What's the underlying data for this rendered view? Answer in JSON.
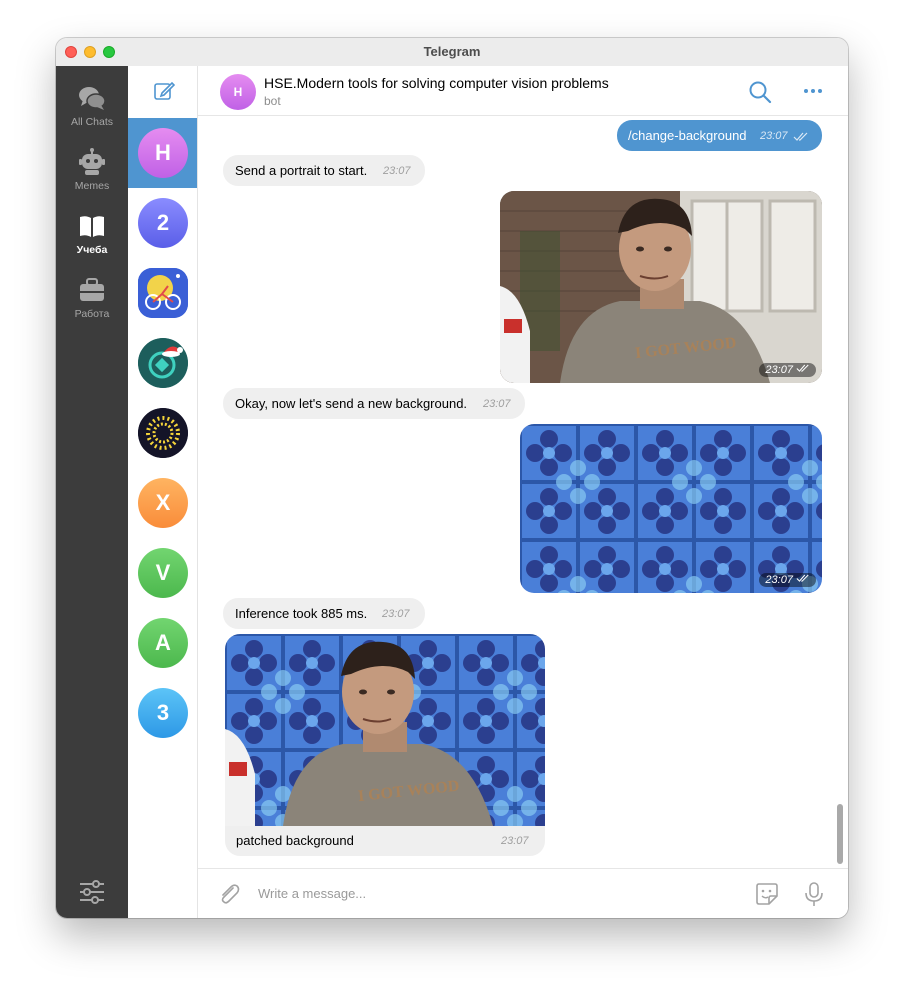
{
  "window": {
    "title": "Telegram"
  },
  "folders": [
    {
      "label": "All Chats",
      "icon": "chat-bubbles-icon"
    },
    {
      "label": "Memes",
      "icon": "robot-icon"
    },
    {
      "label": "Учеба",
      "icon": "book-icon",
      "active": true
    },
    {
      "label": "Работа",
      "icon": "briefcase-icon"
    }
  ],
  "chat_list": {
    "compose_icon": "compose-icon",
    "avatars": [
      {
        "letter": "H",
        "color": "#c866e8",
        "active": true
      },
      {
        "letter": "2",
        "color": "#6c6df2"
      },
      {
        "letter": "",
        "color": "#3f6fe0"
      },
      {
        "letter": "",
        "color": "#1f6e6b"
      },
      {
        "letter": "",
        "color": "#151530"
      },
      {
        "letter": "X",
        "color": "#fb9a45"
      },
      {
        "letter": "V",
        "color": "#58c55b"
      },
      {
        "letter": "A",
        "color": "#58c55b"
      },
      {
        "letter": "3",
        "color": "#3aa6ee"
      }
    ]
  },
  "chat": {
    "avatar_letter": "H",
    "name": "HSE.Modern tools for solving computer vision problems",
    "status": "bot"
  },
  "messages": {
    "m1": {
      "text": "/change-background",
      "time": "23:07"
    },
    "m2": {
      "text": "Send a portrait to start.",
      "time": "23:07"
    },
    "m3": {
      "time": "23:07",
      "shirt_text": "I GOT WOOD"
    },
    "m4": {
      "text": "Okay, now let's send a new background.",
      "time": "23:07"
    },
    "m5": {
      "time": "23:07"
    },
    "m6": {
      "text": "Inference took 885 ms.",
      "time": "23:07"
    },
    "m7": {
      "caption": "patched background",
      "time": "23:07",
      "shirt_text": "I GOT WOOD"
    }
  },
  "composer": {
    "placeholder": "Write a message..."
  },
  "colors": {
    "accent": "#4f95d0",
    "sidebar": "#3c3c3c",
    "incoming_bubble": "#efefef"
  }
}
